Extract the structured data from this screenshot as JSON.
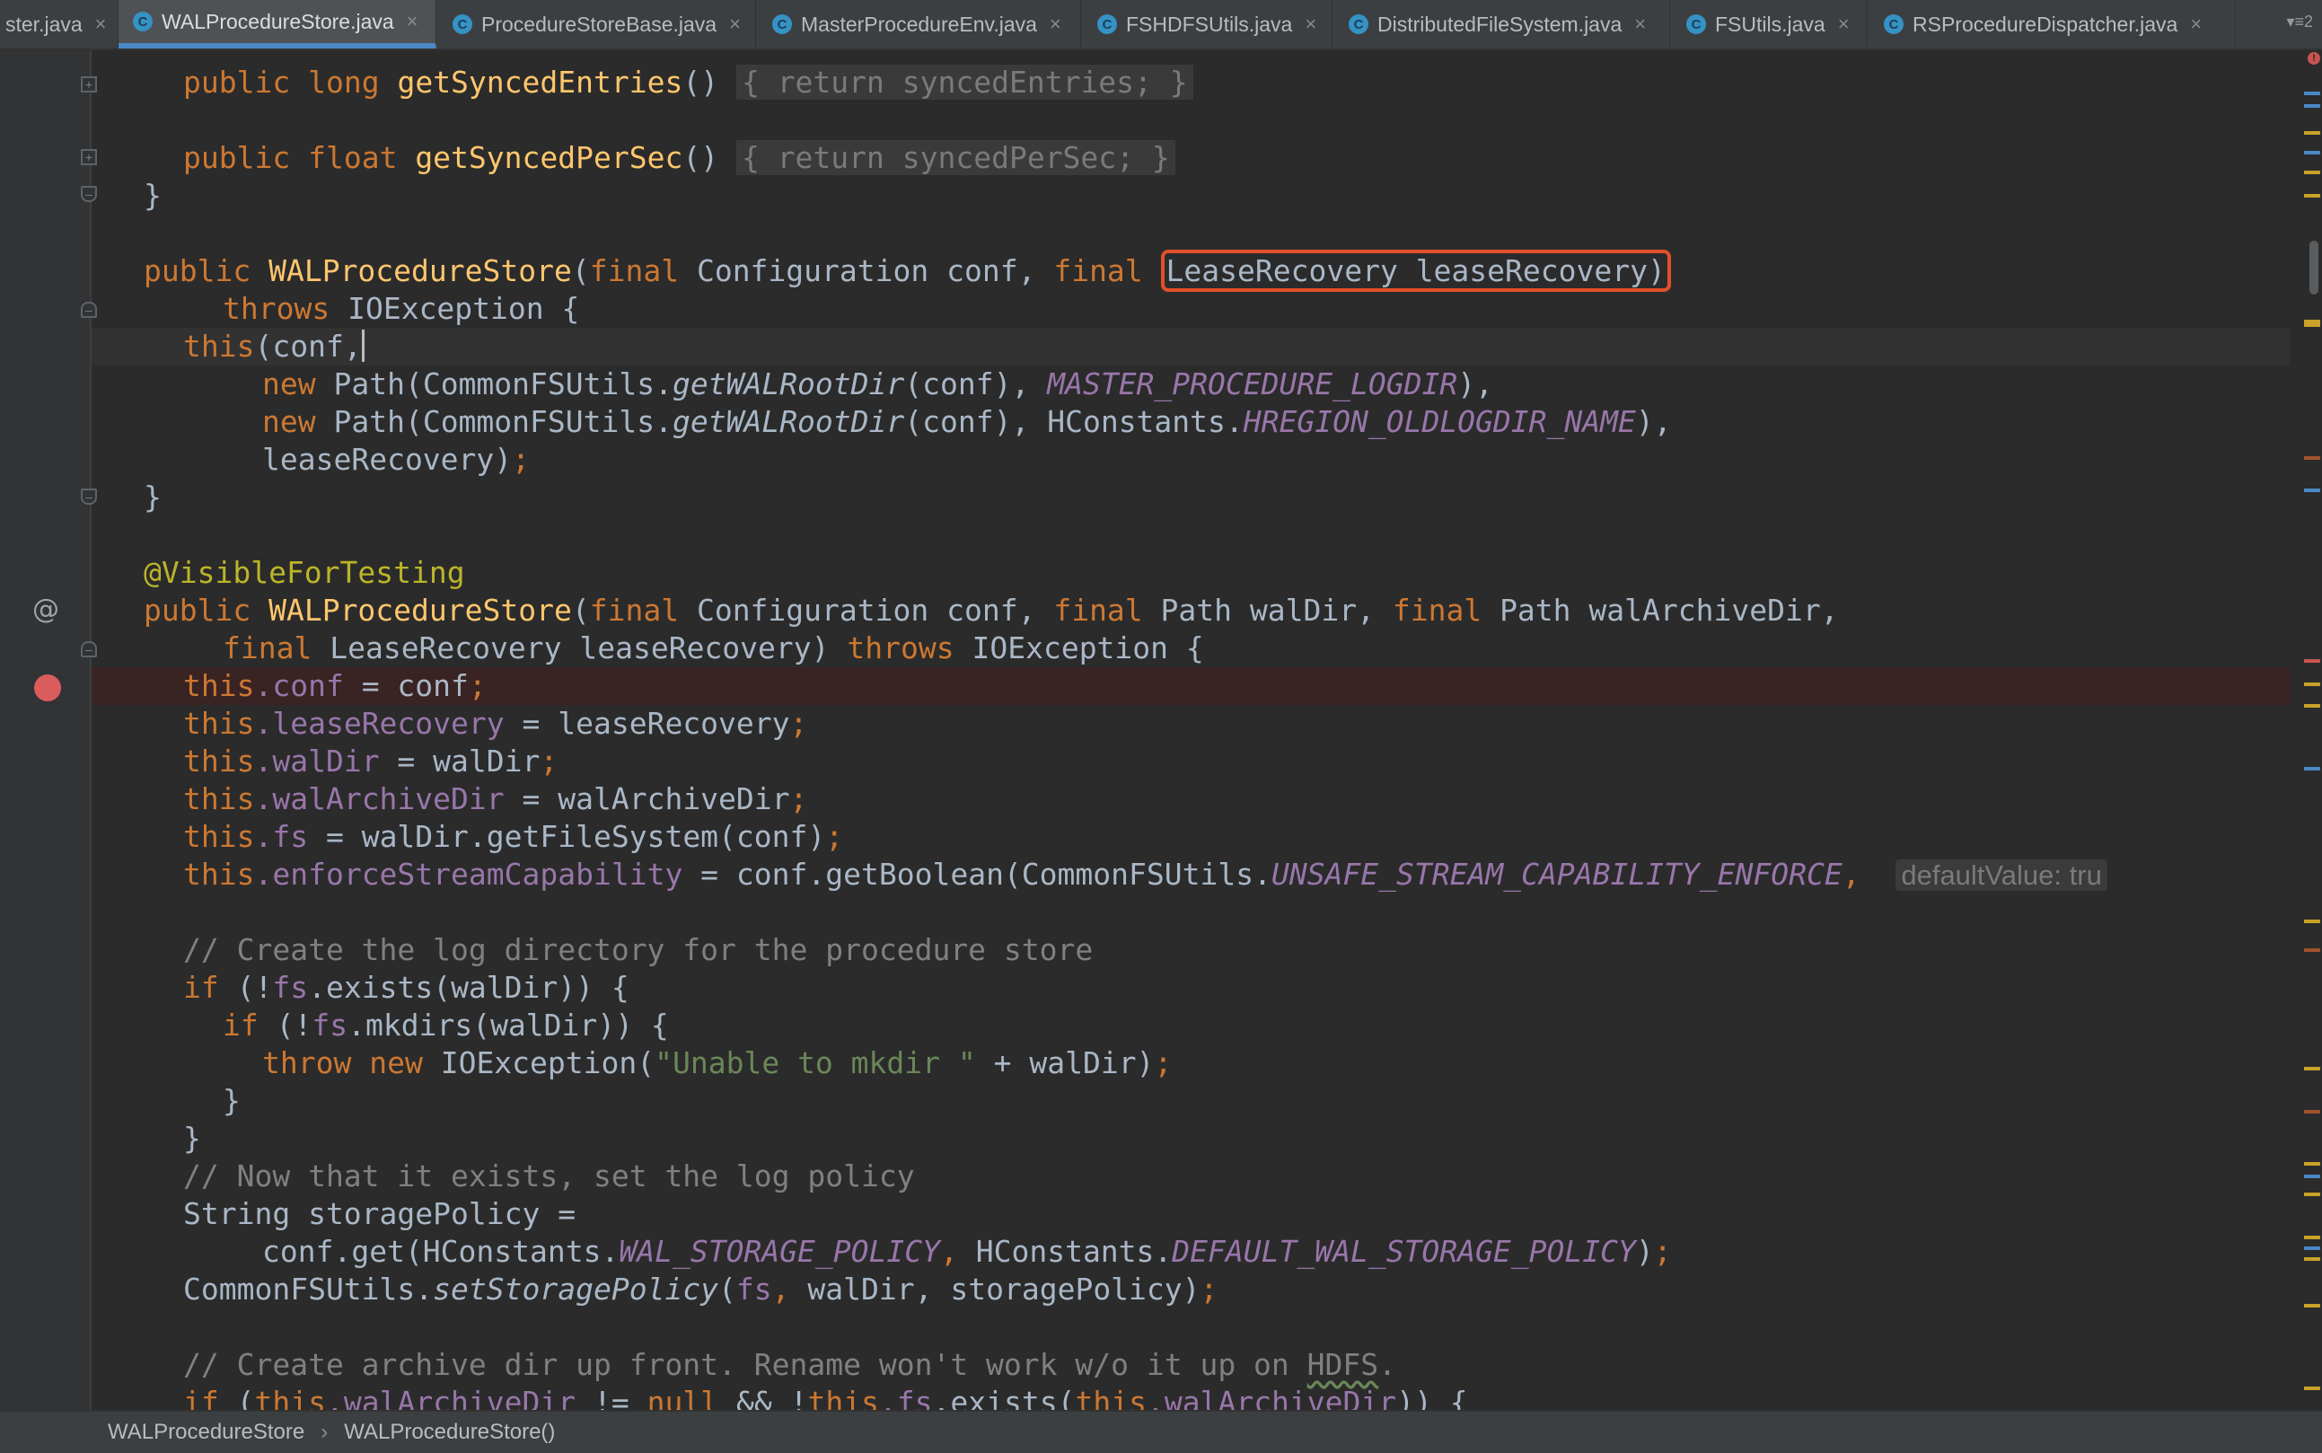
{
  "tabs": [
    {
      "label": "ster.java",
      "active": false,
      "icon": "none"
    },
    {
      "label": "WALProcedureStore.java",
      "active": true,
      "icon": "class-icon"
    },
    {
      "label": "ProcedureStoreBase.java",
      "active": false,
      "icon": "class-icon"
    },
    {
      "label": "MasterProcedureEnv.java",
      "active": false,
      "icon": "class-icon"
    },
    {
      "label": "FSHDFSUtils.java",
      "active": false,
      "icon": "class-icon"
    },
    {
      "label": "DistributedFileSystem.java",
      "active": false,
      "icon": "class-icon"
    },
    {
      "label": "FSUtils.java",
      "active": false,
      "icon": "class-icon"
    },
    {
      "label": "RSProcedureDispatcher.java",
      "active": false,
      "icon": "class-icon"
    }
  ],
  "tab_menu": "▾≡2",
  "code": {
    "l1_pre": "public long ",
    "l1_fn": "getSyncedEntries",
    "l1_mid": "() ",
    "l1_fold": "{ return syncedEntries; }",
    "l1_kw": "public",
    "l1_type": "long",
    "l2_kw": "public",
    "l2_type": "float",
    "l2_fn": "getSyncedPerSec",
    "l2_fold": "{ return syncedPerSec; }",
    "l3_brace": "}",
    "l4_kw1": "public",
    "l4_fn": "WALProcedureStore",
    "l4_final1": "final",
    "l4_p1": "Configuration conf,",
    "l4_final2": "final",
    "l4_highlight": "LeaseRecovery leaseRecovery)",
    "l5_kw": "throws",
    "l5_rest": "IOException {",
    "l6_kw": "this",
    "l6_rest": "(conf,",
    "l7_kw": "new",
    "l7_a": "Path(CommonFSUtils.",
    "l7_st": "getWALRootDir",
    "l7_b": "(conf),",
    "l7_cst": "MASTER_PROCEDURE_LOGDIR",
    "l7_c": "),",
    "l8_kw": "new",
    "l8_a": "Path(CommonFSUtils.",
    "l8_st": "getWALRootDir",
    "l8_b": "(conf),",
    "l8_c": "HConstants.",
    "l8_cst": "HREGION_OLDLOGDIR_NAME",
    "l8_d": "),",
    "l9_a": "leaseRecovery)",
    "l9_semi": ";",
    "l10_brace": "}",
    "l11_ann": "@VisibleForTesting",
    "l12_kw1": "public",
    "l12_fn": "WALProcedureStore",
    "l12_final1": "final",
    "l12_p1": "Configuration conf,",
    "l12_final2": "final",
    "l12_p2": "Path walDir,",
    "l12_final3": "final",
    "l12_p3": "Path walArchiveDir,",
    "l13_final": "final",
    "l13_p": "LeaseRecovery leaseRecovery)",
    "l13_throws": "throws",
    "l13_rest": "IOException {",
    "l14_this": "this",
    "l14_fld": ".conf",
    "l14_rest": " = conf",
    "l15_this": "this",
    "l15_fld": ".leaseRecovery",
    "l15_rest": " = leaseRecovery",
    "l16_this": "this",
    "l16_fld": ".walDir",
    "l16_rest": " = walDir",
    "l17_this": "this",
    "l17_fld": ".walArchiveDir",
    "l17_rest": " = walArchiveDir",
    "l18_this": "this",
    "l18_fld": ".fs",
    "l18_rest": " = walDir.getFileSystem(conf)",
    "l19_this": "this",
    "l19_fld": ".enforceStreamCapability",
    "l19_a": " = conf.getBoolean(CommonFSUtils.",
    "l19_cst": "UNSAFE_STREAM_CAPABILITY_ENFORCE",
    "l19_hint": "defaultValue: tru",
    "l20_cm": "// Create the log directory for the procedure store",
    "l21_kw": "if",
    "l21_a": "(!",
    "l21_fld": "fs",
    "l21_b": ".exists(walDir)) {",
    "l22_kw": "if",
    "l22_a": "(!",
    "l22_fld": "fs",
    "l22_b": ".mkdirs(walDir)) {",
    "l23_kw1": "throw",
    "l23_kw2": "new",
    "l23_a": "IOException(",
    "l23_str": "\"Unable to mkdir \"",
    "l23_b": " + walDir)",
    "l24_brace": "}",
    "l25_brace": "}",
    "l26_cm": "// Now that it exists, set the log policy",
    "l27_a": "String storagePolicy =",
    "l28_a": "conf.get(HConstants.",
    "l28_cst1": "WAL_STORAGE_POLICY",
    "l28_b": "HConstants.",
    "l28_cst2": "DEFAULT_WAL_STORAGE_POLICY",
    "l28_c": ")",
    "l29_a": "CommonFSUtils.",
    "l29_st": "setStoragePolicy",
    "l29_b": "(",
    "l29_fld": "fs",
    "l29_c": "walDir,",
    "l29_d": "storagePolicy)",
    "l30_cm_a": "// Create archive dir up front. Rename won't work w/o it up on ",
    "l30_cm_sq": "HDFS",
    "l30_cm_b": ".",
    "l31_kw": "if",
    "l31_a": "(",
    "l31_this1": "this",
    "l31_fld1": ".walArchiveDir",
    "l31_b": " != ",
    "l31_null": "null",
    "l31_c": " && !",
    "l31_this2": "this",
    "l31_fld2": ".fs",
    "l31_d": ".exists(",
    "l31_this3": "this",
    "l31_fld3": ".walArchiveDir",
    "l31_e": ")) {"
  },
  "breadcrumb": {
    "class": "WALProcedureStore",
    "separator": "›",
    "method": "WALProcedureStore()"
  },
  "colors": {
    "keyword": "#cc7832",
    "function": "#ffc66d",
    "field": "#9876aa",
    "string": "#6a8759",
    "comment": "#808080",
    "annotation": "#bbb529",
    "highlight_box": "#e2502a",
    "breakpoint": "#db5c5c"
  }
}
